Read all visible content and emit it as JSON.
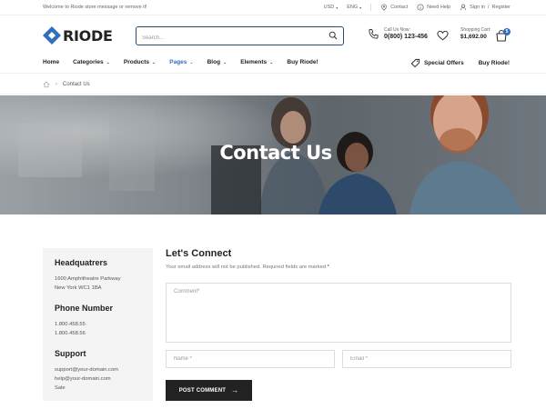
{
  "topbar": {
    "welcome": "Welcome to Riode store message or remove it!",
    "currency": "USD",
    "language": "ENG",
    "contact": "Contact",
    "need_help": "Need Help",
    "sign_in": "Sign in",
    "divider": "/",
    "register": "Register"
  },
  "header": {
    "logo_text": "RIODE",
    "search_placeholder": "Search...",
    "call_label": "Call Us Now:",
    "call_number": "0(800) 123-456",
    "cart_label": "Shopping Cart:",
    "cart_total": "$1,692.00",
    "cart_count": "5"
  },
  "nav": {
    "items": [
      {
        "label": "Home",
        "has_dropdown": false
      },
      {
        "label": "Categories",
        "has_dropdown": true
      },
      {
        "label": "Products",
        "has_dropdown": true
      },
      {
        "label": "Pages",
        "has_dropdown": true,
        "active": true
      },
      {
        "label": "Blog",
        "has_dropdown": true
      },
      {
        "label": "Elements",
        "has_dropdown": true
      },
      {
        "label": "Buy Riode!",
        "has_dropdown": false
      }
    ],
    "special_offers": "Special Offers",
    "buy_riode": "Buy Riode!"
  },
  "breadcrumb": {
    "current": "Contact Us"
  },
  "hero": {
    "title": "Contact Us"
  },
  "info": {
    "headquarters_title": "Headquatrers",
    "address_line1": "1600 Amphitheatre Parkway",
    "address_line2": "New York WC1 1BA",
    "phone_title": "Phone Number",
    "phone1": "1.800.458.55",
    "phone2": "1.800.458.56",
    "support_title": "Support",
    "support_email1": "support@your-domain.com",
    "support_email2": "help@your-domain.com",
    "support_sale": "Sale"
  },
  "form": {
    "title": "Let's Connect",
    "note": "Your email address will not be published. Required fields are marked",
    "note_star": "*",
    "comment_placeholder": "Comment*",
    "name_placeholder": "Name *",
    "email_placeholder": "Email *",
    "submit_label": "POST COMMENT",
    "submit_arrow": "→"
  },
  "colors": {
    "accent": "#2e6fbf",
    "dark": "#222222",
    "search_border": "#2b4a72",
    "info_bg": "#f4f4f5"
  }
}
